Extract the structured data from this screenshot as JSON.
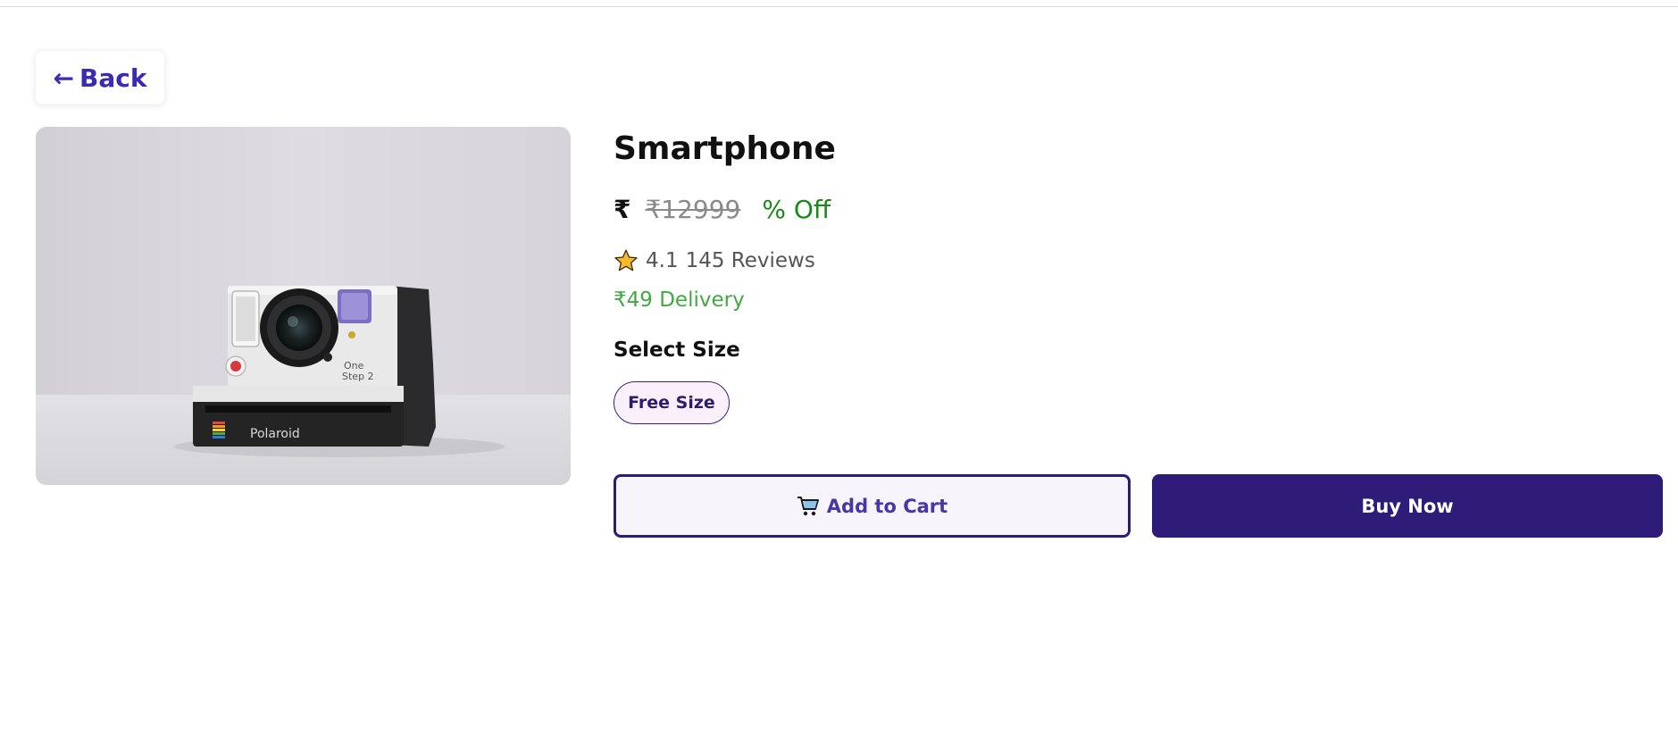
{
  "nav": {
    "back_arrow": "←",
    "back_label": "Back"
  },
  "product": {
    "image_icon": "instant-camera-photo",
    "title": "Smartphone",
    "price_symbol": "₹",
    "original_price": "₹12999",
    "discount": "% Off",
    "rating": "4.1",
    "reviews": "145 Reviews",
    "delivery": "₹49 Delivery",
    "size_heading": "Select Size",
    "sizes": [
      "Free Size"
    ],
    "image_caption": "Polaroid",
    "image_model_line1": "One",
    "image_model_line2": "Step 2"
  },
  "actions": {
    "add_to_cart": "Add to Cart",
    "buy_now": "Buy Now"
  },
  "colors": {
    "accent": "#2f1c78",
    "link": "#3b2bb3",
    "discount": "#178a17",
    "delivery": "#43a843",
    "star": "#f5b82e"
  }
}
